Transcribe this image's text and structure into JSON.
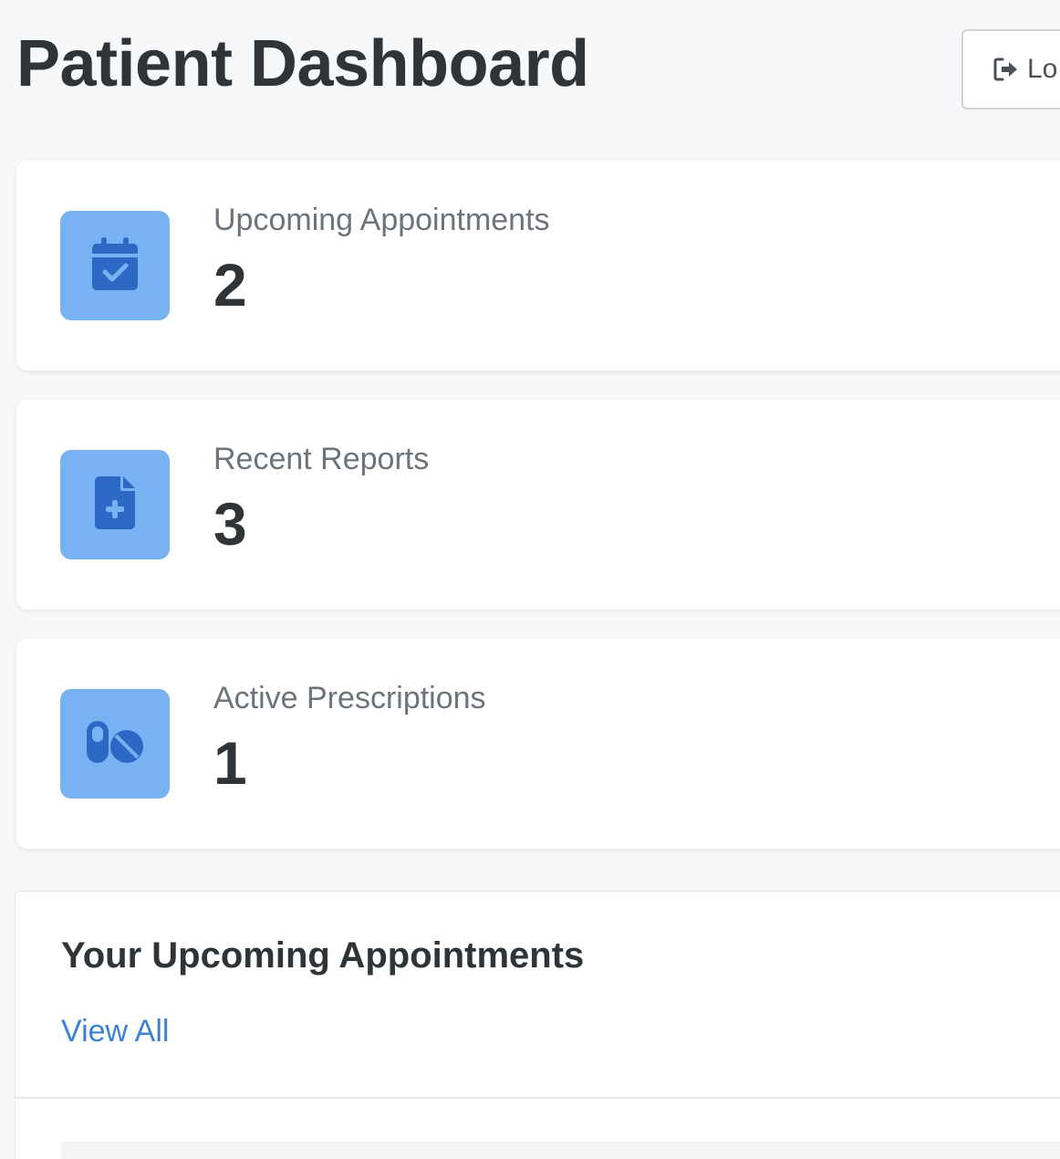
{
  "page": {
    "title": "Patient Dashboard"
  },
  "header": {
    "logout_label": "Lo",
    "logout_icon": "sign-out-icon"
  },
  "colors": {
    "icon_tile_bg": "#78b2f2",
    "icon_fg": "#2d68c4",
    "link": "#3a82d4"
  },
  "stats": [
    {
      "label": "Upcoming Appointments",
      "value": "2",
      "icon": "calendar-check-icon"
    },
    {
      "label": "Recent Reports",
      "value": "3",
      "icon": "file-medical-icon"
    },
    {
      "label": "Active Prescriptions",
      "value": "1",
      "icon": "pills-icon"
    }
  ],
  "appointments_panel": {
    "title": "Your Upcoming Appointments",
    "view_all_label": "View All"
  }
}
